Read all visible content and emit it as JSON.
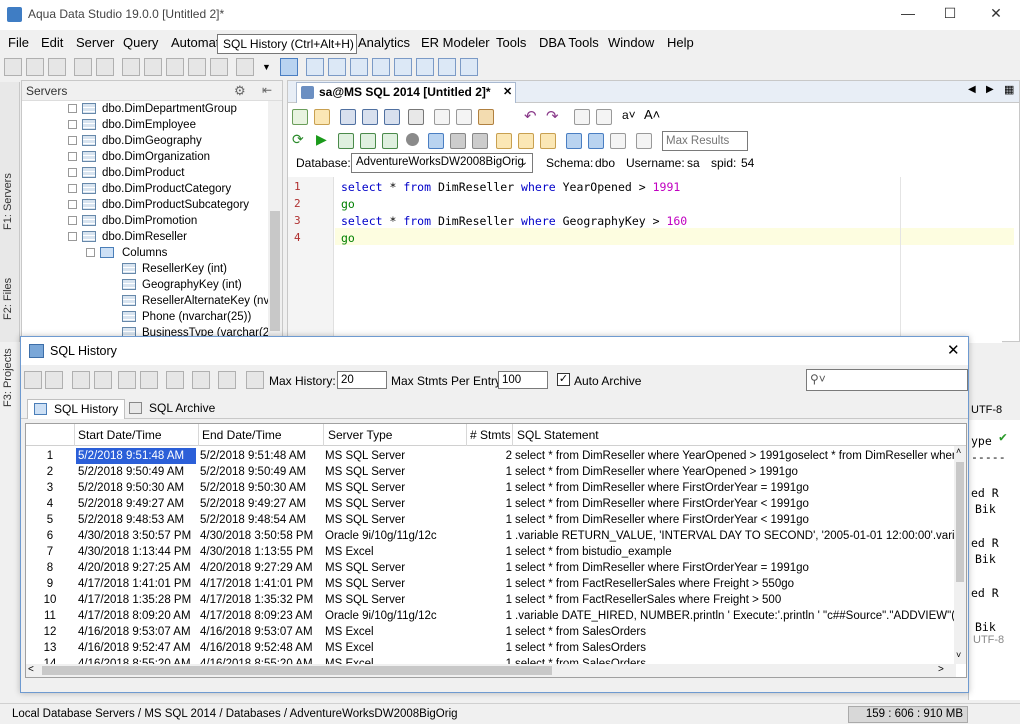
{
  "app_title": "Aqua Data Studio 19.0.0 [Untitled 2]*",
  "menu": [
    "File",
    "Edit",
    "Server",
    "Query",
    "Automat",
    "Analytics",
    "ER Modeler",
    "Tools",
    "DBA Tools",
    "Window",
    "Help"
  ],
  "tooltip": "SQL History (Ctrl+Alt+H)",
  "side_tabs": [
    "F1: Servers",
    "F2: Files",
    "F3: Projects"
  ],
  "servers_panel": {
    "title": "Servers",
    "tree": [
      {
        "label": "dbo.DimDepartmentGroup"
      },
      {
        "label": "dbo.DimEmployee"
      },
      {
        "label": "dbo.DimGeography"
      },
      {
        "label": "dbo.DimOrganization"
      },
      {
        "label": "dbo.DimProduct"
      },
      {
        "label": "dbo.DimProductCategory"
      },
      {
        "label": "dbo.DimProductSubcategory"
      },
      {
        "label": "dbo.DimPromotion"
      },
      {
        "label": "dbo.DimReseller"
      },
      {
        "label": "Columns"
      },
      {
        "label": "ResellerKey (int)"
      },
      {
        "label": "GeographyKey (int)"
      },
      {
        "label": "ResellerAlternateKey (nva"
      },
      {
        "label": "Phone (nvarchar(25))"
      },
      {
        "label": "BusinessType (varchar(20"
      }
    ]
  },
  "editor": {
    "tab_label": "sa@MS SQL 2014 [Untitled 2]*",
    "max_results_placeholder": "Max Results",
    "database_label": "Database:",
    "database_value": "AdventureWorksDW2008BigOrig",
    "schema_label": "Schema:",
    "schema_value": "dbo",
    "username_label": "Username:",
    "username_value": "sa",
    "spid_label": "spid:",
    "spid_value": "54",
    "lines": [
      {
        "num": "1",
        "kw1": "select",
        "rest1": " * ",
        "kw2": "from",
        "rest2": " DimReseller ",
        "kw3": "where",
        "rest3": " YearOpened > ",
        "val": "1991"
      },
      {
        "num": "2",
        "go": "go"
      },
      {
        "num": "3",
        "kw1": "select",
        "rest1": " * ",
        "kw2": "from",
        "rest2": " DimReseller ",
        "kw3": "where",
        "rest3": " GeographyKey > ",
        "val": "160"
      },
      {
        "num": "4",
        "go": "go"
      }
    ]
  },
  "history": {
    "title": "SQL History",
    "max_history_label": "Max History:",
    "max_history_value": "20",
    "max_stmts_label": "Max Stmts Per Entry:",
    "max_stmts_value": "100",
    "auto_archive_label": "Auto Archive",
    "auto_archive_checked": true,
    "tabs": [
      "SQL History",
      "SQL Archive"
    ],
    "columns": [
      "Start Date/Time",
      "End Date/Time",
      "Server Type",
      "# Stmts",
      "SQL Statement"
    ],
    "rows": [
      [
        "1",
        "5/2/2018 9:51:48 AM",
        "5/2/2018 9:51:48 AM",
        "MS SQL Server",
        "2",
        "select * from DimReseller where YearOpened > 1991goselect * from DimReseller where Ge"
      ],
      [
        "2",
        "5/2/2018 9:50:49 AM",
        "5/2/2018 9:50:49 AM",
        "MS SQL Server",
        "1",
        "select * from DimReseller where YearOpened > 1991go"
      ],
      [
        "3",
        "5/2/2018 9:50:30 AM",
        "5/2/2018 9:50:30 AM",
        "MS SQL Server",
        "1",
        "select * from DimReseller where FirstOrderYear = 1991go"
      ],
      [
        "4",
        "5/2/2018 9:49:27 AM",
        "5/2/2018 9:49:27 AM",
        "MS SQL Server",
        "1",
        "select * from DimReseller where FirstOrderYear < 1991go"
      ],
      [
        "5",
        "5/2/2018 9:48:53 AM",
        "5/2/2018 9:48:54 AM",
        "MS SQL Server",
        "1",
        "select * from DimReseller where FirstOrderYear < 1991go"
      ],
      [
        "6",
        "4/30/2018 3:50:57 PM",
        "4/30/2018 3:50:58 PM",
        "Oracle 9i/10g/11g/12c",
        "1",
        ".variable RETURN_VALUE, 'INTERVAL DAY TO SECOND', '2005-01-01 12:00:00'.variable LE"
      ],
      [
        "7",
        "4/30/2018 1:13:44 PM",
        "4/30/2018 1:13:55 PM",
        "MS Excel",
        "1",
        "select * from bistudio_example"
      ],
      [
        "8",
        "4/20/2018 9:27:25 AM",
        "4/20/2018 9:27:29 AM",
        "MS SQL Server",
        "1",
        "select * from DimReseller where FirstOrderYear = 1991go"
      ],
      [
        "9",
        "4/17/2018 1:41:01 PM",
        "4/17/2018 1:41:01 PM",
        "MS SQL Server",
        "1",
        "select * from FactResellerSales where Freight > 550go"
      ],
      [
        "10",
        "4/17/2018 1:35:28 PM",
        "4/17/2018 1:35:32 PM",
        "MS SQL Server",
        "1",
        "select * from FactResellerSales where Freight > 500"
      ],
      [
        "11",
        "4/17/2018 8:09:20 AM",
        "4/17/2018 8:09:23 AM",
        "Oracle 9i/10g/11g/12c",
        "1",
        ".variable DATE_HIRED, NUMBER.println ' Execute:'.println '      \"c##Source\".\"ADDVIEW\"( ["
      ],
      [
        "12",
        "4/16/2018 9:53:07 AM",
        "4/16/2018 9:53:07 AM",
        "MS Excel",
        "1",
        "select * from SalesOrders"
      ],
      [
        "13",
        "4/16/2018 9:52:47 AM",
        "4/16/2018 9:52:48 AM",
        "MS Excel",
        "1",
        "select * from SalesOrders"
      ],
      [
        "14",
        "4/16/2018 8:55:20 AM",
        "4/16/2018 8:55:20 AM",
        "MS Excel",
        "1",
        "select * from SalesOrders"
      ]
    ]
  },
  "bottom_tab_fragment": "F5: Detail",
  "right_strip": {
    "type_label": "ype",
    "enc_label": "UTF-8",
    "enc_label2": "UTF-8",
    "dashes": "-----",
    "lines": [
      "ed R",
      "Bik",
      "ed R",
      "Bik",
      "ed R",
      "Bik"
    ]
  },
  "status": {
    "path": "Local Database Servers / MS SQL 2014 / Databases / AdventureWorksDW2008BigOrig",
    "memory": "159 : 606 : 910 MB"
  }
}
